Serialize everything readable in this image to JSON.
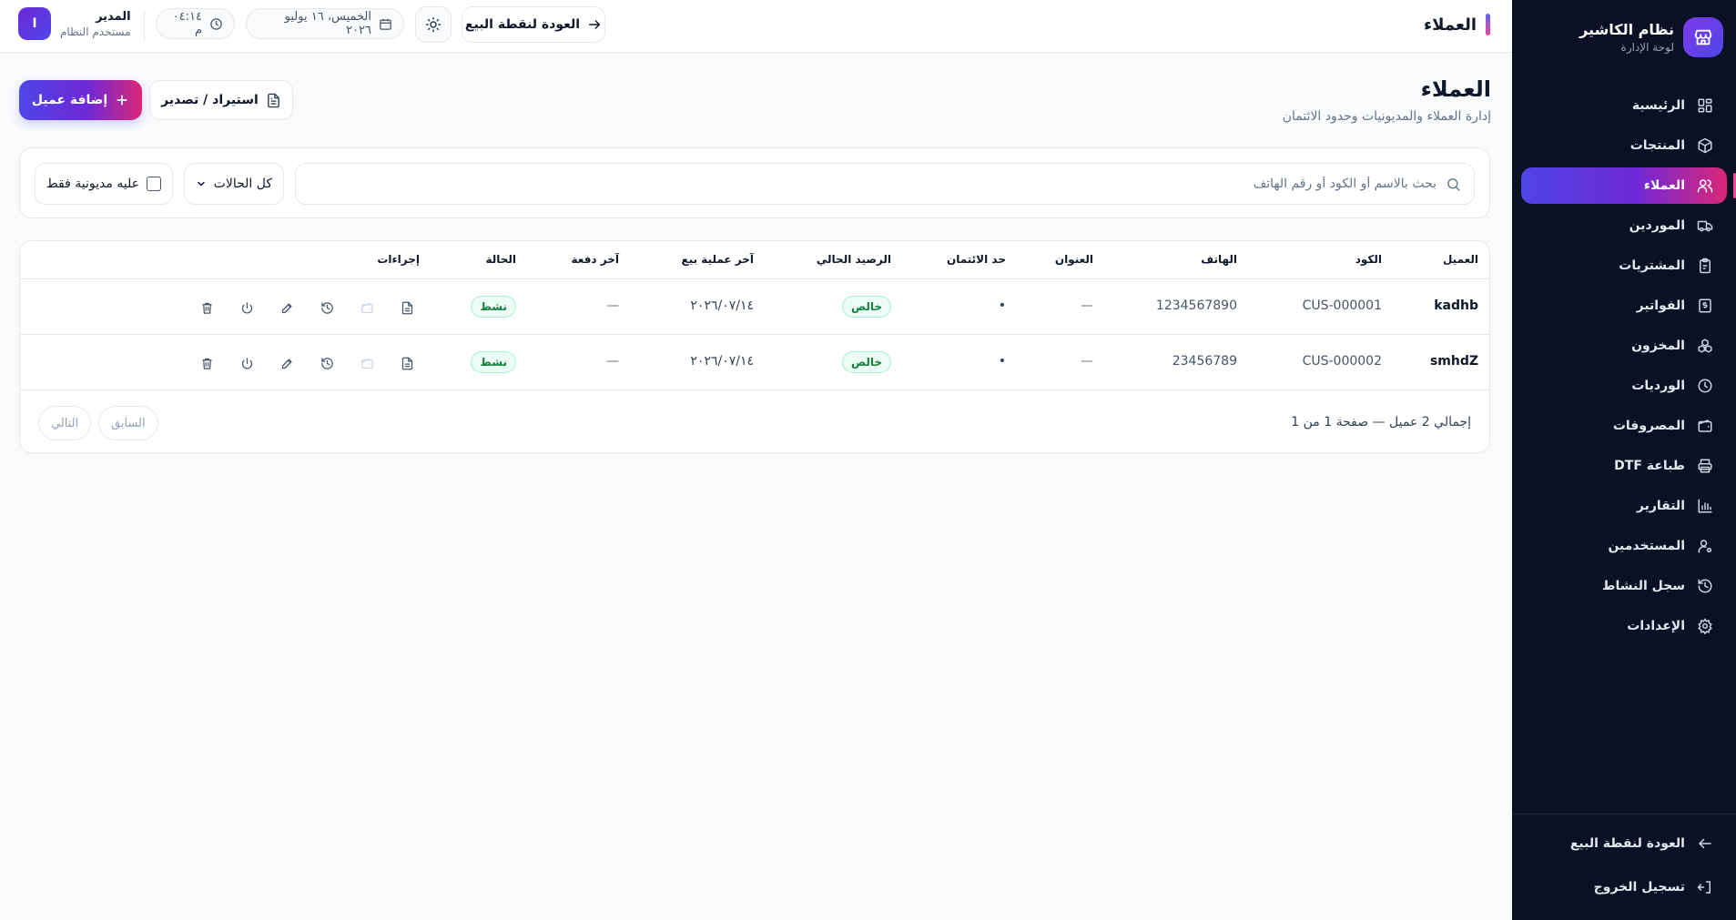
{
  "sidebar": {
    "brand_title": "نظام الكاشير",
    "brand_subtitle": "لوحة الإدارة",
    "items": [
      {
        "label": "الرئيسية",
        "icon": "dashboard-icon"
      },
      {
        "label": "المنتجات",
        "icon": "box-icon"
      },
      {
        "label": "العملاء",
        "icon": "users-icon",
        "active": true
      },
      {
        "label": "الموردين",
        "icon": "truck-icon"
      },
      {
        "label": "المشتريات",
        "icon": "clipboard-icon"
      },
      {
        "label": "الفواتير",
        "icon": "receipt-icon"
      },
      {
        "label": "المخزون",
        "icon": "boxes-icon"
      },
      {
        "label": "الورديات",
        "icon": "clock-icon"
      },
      {
        "label": "المصروفات",
        "icon": "wallet-icon"
      },
      {
        "label": "طباعة DTF",
        "icon": "printer-icon"
      },
      {
        "label": "التقارير",
        "icon": "chart-icon"
      },
      {
        "label": "المستخدمين",
        "icon": "user-cog-icon"
      },
      {
        "label": "سجل النشاط",
        "icon": "history-icon"
      },
      {
        "label": "الإعدادات",
        "icon": "gear-icon"
      }
    ],
    "back_to_pos": "العودة لنقطة البيع",
    "logout": "تسجيل الخروج"
  },
  "topbar": {
    "title": "العملاء",
    "back_button": "العودة لنقطة البيع",
    "date": "الخميس، ١٦ يوليو ٢٠٢٦",
    "time": "٠٤:١٤ م",
    "user_initial": "ا",
    "user_name": "المدير",
    "user_role": "مستخدم النظام"
  },
  "page": {
    "title": "العملاء",
    "subtitle": "إدارة العملاء والمديونيات وحدود الائتمان",
    "add_button": "إضافة عميل",
    "import_export_button": "استيراد / تصدير"
  },
  "filters": {
    "search_placeholder": "بحث بالاسم أو الكود أو رقم الهاتف",
    "search_value": "",
    "status_selected": "كل الحالات",
    "debt_only_label": "عليه مديونية فقط",
    "debt_only_checked": false
  },
  "table": {
    "columns": {
      "customer": "العميل",
      "code": "الكود",
      "phone": "الهاتف",
      "address": "العنوان",
      "credit_limit": "حد الائتمان",
      "balance": "الرصيد الحالي",
      "last_sale": "آخر عملية بيع",
      "last_payment": "آخر دفعة",
      "status": "الحالة",
      "actions": "إجراءات"
    },
    "rows": [
      {
        "name": "kadhb",
        "code": "CUS-000001",
        "phone": "1234567890",
        "address": "—",
        "credit_limit": "•",
        "balance": "خالص",
        "last_sale": "٢٠٢٦/٠٧/١٤",
        "last_payment": "—",
        "status": "نشط"
      },
      {
        "name": "smhdZ",
        "code": "CUS-000002",
        "phone": "23456789",
        "address": "—",
        "credit_limit": "•",
        "balance": "خالص",
        "last_sale": "٢٠٢٦/٠٧/١٤",
        "last_payment": "—",
        "status": "نشط"
      }
    ],
    "total_text": "إجمالي 2 عميل — صفحة 1 من 1",
    "prev_label": "السابق",
    "next_label": "التالي"
  },
  "colors": {
    "sidebar_bg": "#0b1024",
    "accent_gradient_start": "#4f46e5",
    "accent_gradient_mid": "#6d28d9",
    "accent_gradient_end": "#db2777",
    "status_green": "#15803d",
    "page_bg": "#f8fafc"
  }
}
